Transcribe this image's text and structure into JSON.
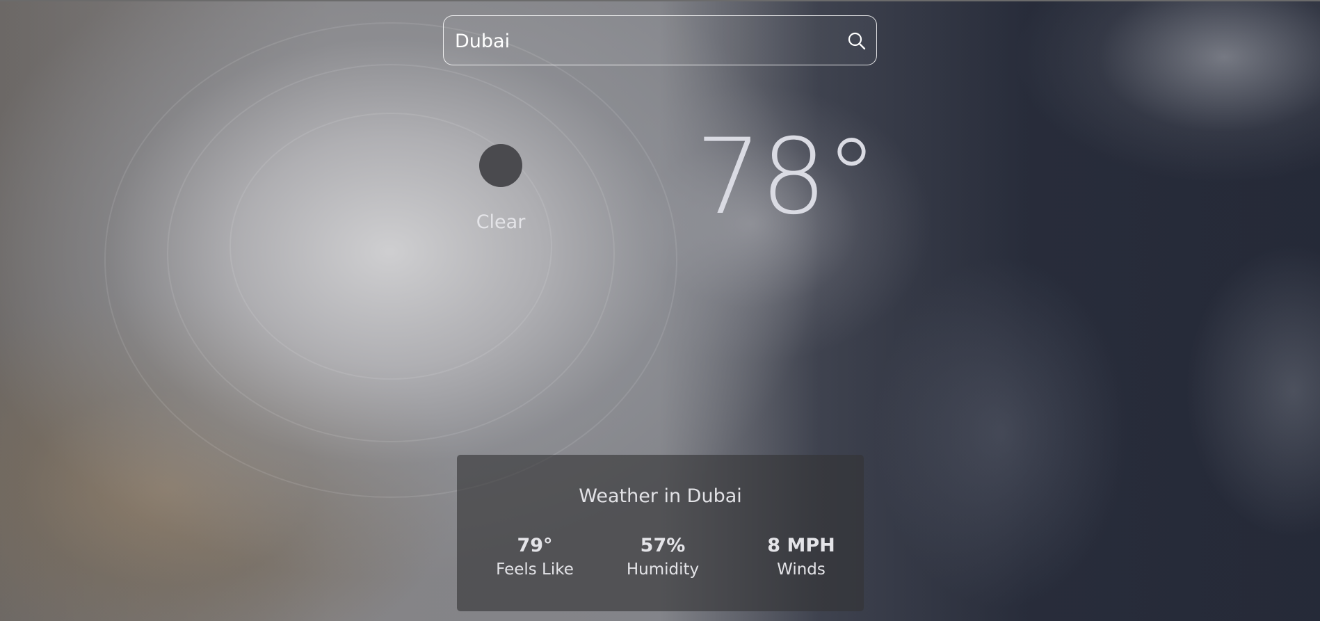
{
  "search": {
    "value": "Dubai",
    "icon": "search-icon"
  },
  "current": {
    "condition": "Clear",
    "condition_icon": "clear-weather-icon",
    "temperature": "78°"
  },
  "details": {
    "title": "Weather in Dubai",
    "stats": [
      {
        "value": "79°",
        "label": "Feels Like"
      },
      {
        "value": "57%",
        "label": "Humidity"
      },
      {
        "value": "8 MPH",
        "label": "Winds"
      }
    ]
  },
  "colors": {
    "text": "#e4e4e8",
    "panel": "#343436",
    "icon": "#4a4a4e"
  }
}
